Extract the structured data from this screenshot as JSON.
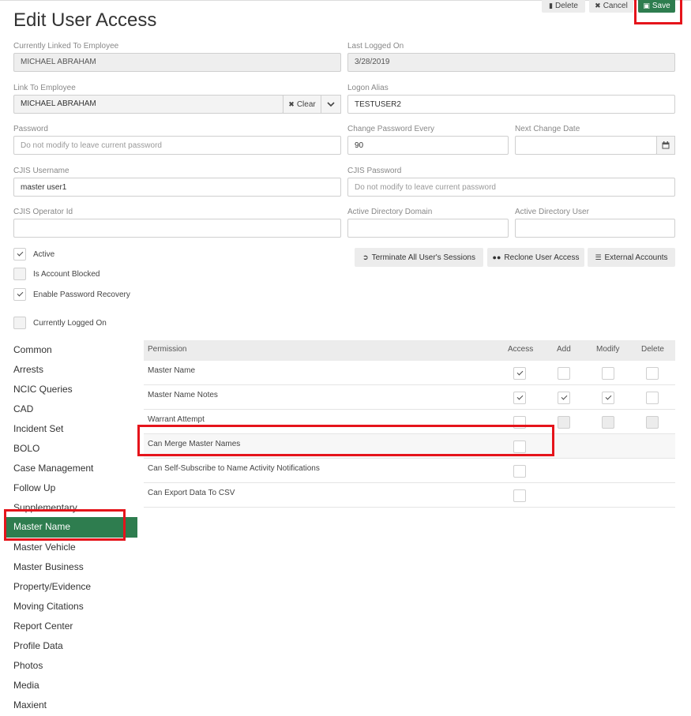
{
  "page": {
    "title": "Edit User Access"
  },
  "toolbar": {
    "delete_label": "Delete",
    "cancel_label": "Cancel",
    "save_label": "Save"
  },
  "form": {
    "linked_employee": {
      "label": "Currently Linked To Employee",
      "value": "MICHAEL ABRAHAM"
    },
    "last_logged_on": {
      "label": "Last Logged On",
      "value": "3/28/2019"
    },
    "link_to_employee": {
      "label": "Link To Employee",
      "value": "MICHAEL ABRAHAM",
      "clear_label": "Clear"
    },
    "logon_alias": {
      "label": "Logon Alias",
      "value": "TESTUSER2"
    },
    "password": {
      "label": "Password",
      "placeholder": "Do not modify to leave current password"
    },
    "change_password_every": {
      "label": "Change Password Every",
      "value": "90"
    },
    "next_change_date": {
      "label": "Next Change Date",
      "value": ""
    },
    "cjis_username": {
      "label": "CJIS Username",
      "value": "master user1"
    },
    "cjis_password": {
      "label": "CJIS Password",
      "placeholder": "Do not modify to leave current password"
    },
    "cjis_operator_id": {
      "label": "CJIS Operator Id",
      "value": ""
    },
    "ad_domain": {
      "label": "Active Directory Domain",
      "value": ""
    },
    "ad_user": {
      "label": "Active Directory User",
      "value": ""
    }
  },
  "checks": {
    "active": {
      "label": "Active",
      "checked": true
    },
    "blocked": {
      "label": "Is Account Blocked",
      "checked": false
    },
    "recovery": {
      "label": "Enable Password Recovery",
      "checked": true
    },
    "logged_on": {
      "label": "Currently Logged On",
      "checked": false
    }
  },
  "actions": {
    "terminate": "Terminate All User's Sessions",
    "reclone": "Reclone User Access",
    "external": "External Accounts"
  },
  "sidebar": {
    "selected": "Master Name",
    "items": [
      "Common",
      "Arrests",
      "NCIC Queries",
      "CAD",
      "Incident Set",
      "BOLO",
      "Case Management",
      "Follow Up",
      "Supplementary",
      "Master Name",
      "Master Vehicle",
      "Master Business",
      "Property/Evidence",
      "Moving Citations",
      "Report Center",
      "Profile Data",
      "Photos",
      "Media",
      "Maxient"
    ]
  },
  "permissions": {
    "headers": {
      "permission": "Permission",
      "access": "Access",
      "add": "Add",
      "modify": "Modify",
      "delete": "Delete"
    },
    "rows": [
      {
        "name": "Master Name",
        "access": true,
        "add": false,
        "modify": false,
        "delete": false
      },
      {
        "name": "Master Name Notes",
        "access": true,
        "add": true,
        "modify": true,
        "delete": false
      },
      {
        "name": "Warrant Attempt",
        "access": false,
        "add": false,
        "modify": false,
        "delete": false
      },
      {
        "name": "Can Merge Master Names",
        "access": false
      },
      {
        "name": "Can Self-Subscribe to Name Activity Notifications",
        "access": false
      },
      {
        "name": "Can Export Data To CSV",
        "access": false
      }
    ]
  },
  "colors": {
    "accent": "#2e7d4f",
    "highlight": "#e5141b"
  }
}
